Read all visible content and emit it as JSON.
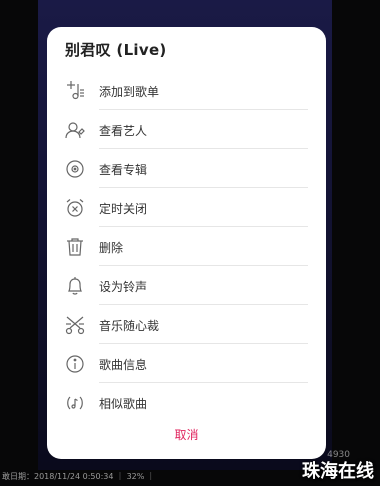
{
  "sheet": {
    "title": "别君叹 (Live)",
    "cancel_label": "取消"
  },
  "menu": [
    {
      "label": "添加到歌单",
      "icon": "add-to-playlist-icon"
    },
    {
      "label": "查看艺人",
      "icon": "artist-icon"
    },
    {
      "label": "查看专辑",
      "icon": "album-icon"
    },
    {
      "label": "定时关闭",
      "icon": "timer-icon"
    },
    {
      "label": "删除",
      "icon": "trash-icon"
    },
    {
      "label": "设为铃声",
      "icon": "bell-icon"
    },
    {
      "label": "音乐随心裁",
      "icon": "scissors-icon"
    },
    {
      "label": "歌曲信息",
      "icon": "info-icon"
    },
    {
      "label": "相似歌曲",
      "icon": "similar-songs-icon"
    }
  ],
  "footer": {
    "text": "敢日期：2018/11/24 0:50:34 ｜ 32% ｜"
  },
  "watermark": {
    "text": "珠海在线",
    "small": "4930"
  },
  "colors": {
    "accent": "#e0245e",
    "sheet_bg": "#ffffff",
    "background": "#070708"
  }
}
